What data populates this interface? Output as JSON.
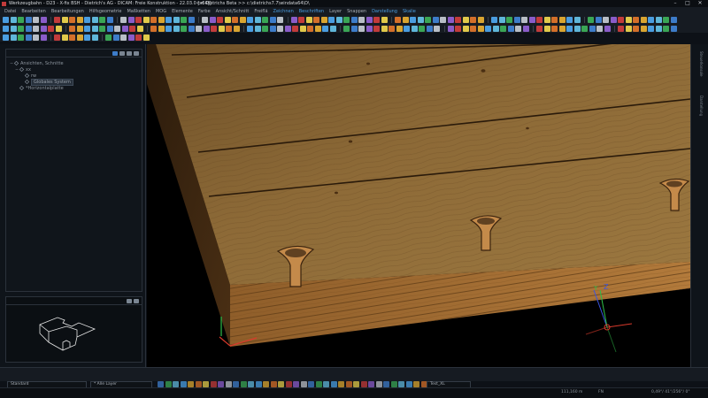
{
  "titlebar": {
    "title": "Werkzeugbahn - D23 - X-fix BSH - Dietrich's AG - DICAM: Freie Konstruktion - 22.03.0 [x64]]",
    "mid": "<< Dietrichs Beta >> c:\\dietrichs7.7\\windata64\\D\\",
    "controls": [
      "–",
      "□",
      "✕"
    ]
  },
  "menubar": {
    "items": [
      "Datei",
      "Bearbeiten",
      "Bearbeitungen",
      "Hilfsgeometrie",
      "Maßketten",
      "MOG",
      "Elemente",
      "Farbe",
      "Ansicht/Schnitt",
      "Freiflä",
      "Zeichnen",
      "Beschriften",
      "Layer",
      "Snappen",
      "Darstellung",
      "Skalie"
    ]
  },
  "tree": {
    "items": [
      {
        "label": "Ansichten, Schnitte",
        "level": 0,
        "expander": "−"
      },
      {
        "label": "xx",
        "level": 1,
        "expander": "−"
      },
      {
        "label": "rw",
        "level": 2,
        "expander": ""
      },
      {
        "label": "Globales System",
        "level": 2,
        "expander": "",
        "selected": true
      },
      {
        "label": "*Horizontalplatte",
        "level": 1,
        "expander": ""
      }
    ]
  },
  "right_tabs": [
    "Steuerkonsole",
    "Darstellung"
  ],
  "axes": {
    "x": "X",
    "y": "Y",
    "z": "Z"
  },
  "status": {
    "field1": "Standard",
    "field2": "* Alle Layer",
    "field3": "Test_XL",
    "coord1": "111,160 m",
    "coord2": "FN",
    "coord3": "0,49°/ 41°/256°/ 0°"
  },
  "colors": {
    "accent_blue": "#3d7cc9",
    "wood_top": "#8a6634",
    "wood_side": "#a06c33",
    "axis_x": "#d83a2c",
    "axis_y": "#2fbf4a",
    "axis_z": "#3a55e0"
  }
}
